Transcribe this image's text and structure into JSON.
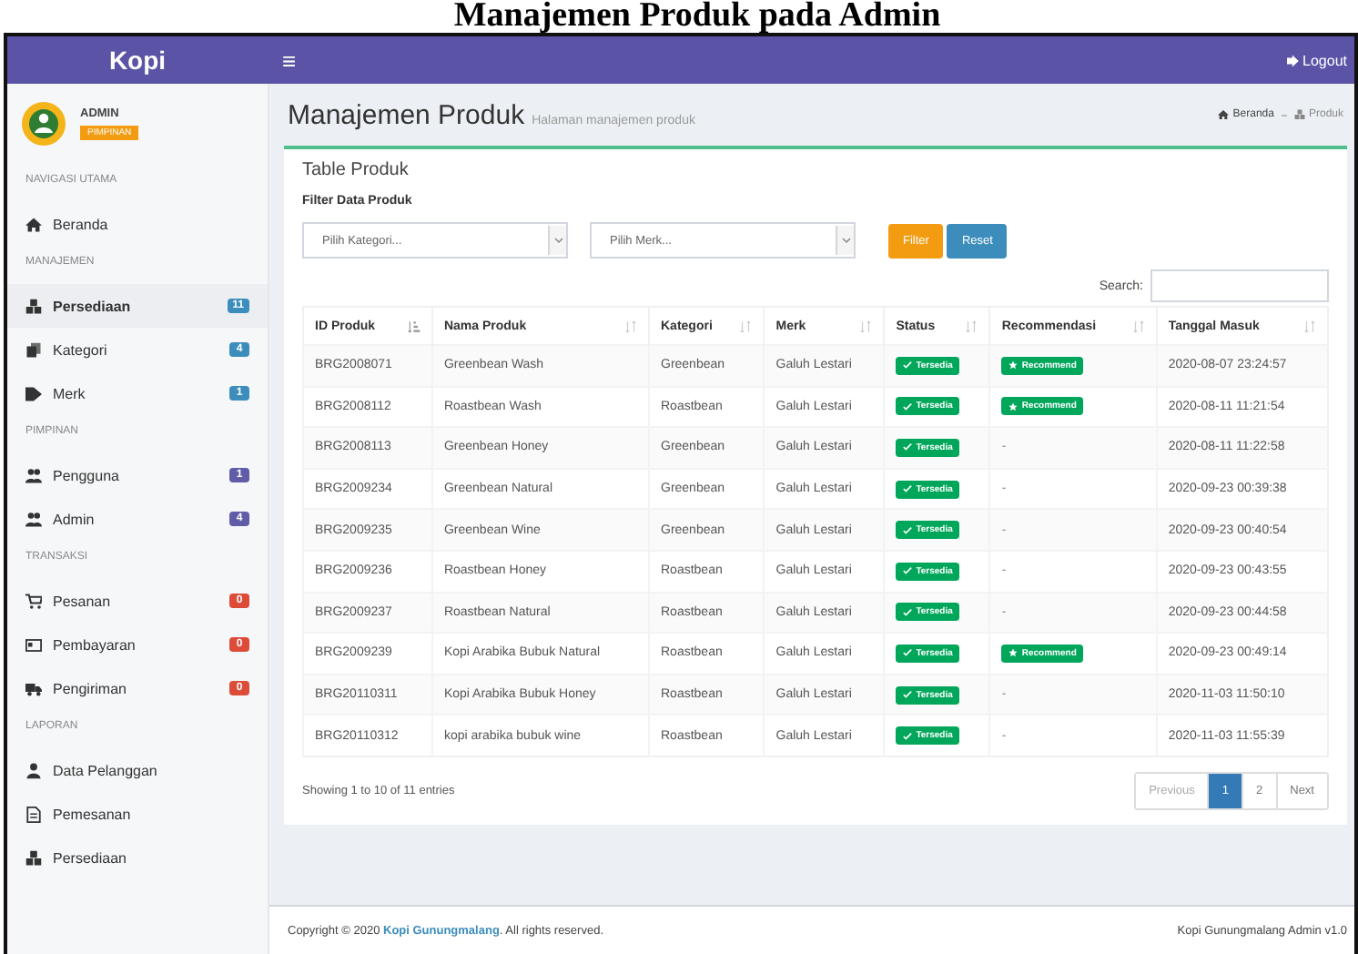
{
  "caption": "Manajemen Produk pada Admin",
  "topbar": {
    "brand": "Kopi",
    "menu_glyph": "≡",
    "logout": "Logout"
  },
  "user": {
    "name": "ADMIN",
    "role": "PIMPINAN"
  },
  "sidebar": [
    {
      "kind": "header",
      "label": "NAVIGASI UTAMA"
    },
    {
      "kind": "link",
      "label": "Beranda",
      "selected": false
    },
    {
      "kind": "header",
      "label": "MANAJEMEN"
    },
    {
      "kind": "link",
      "label": "Persediaan",
      "selected": true,
      "badge": "11",
      "color": "#3c8dbc"
    },
    {
      "kind": "link",
      "label": "Kategori",
      "selected": false,
      "badge": "4",
      "color": "#3c8dbc"
    },
    {
      "kind": "link",
      "label": "Merk",
      "selected": false,
      "badge": "1",
      "color": "#3c8dbc"
    },
    {
      "kind": "header",
      "label": "PIMPINAN"
    },
    {
      "kind": "link",
      "label": "Pengguna",
      "selected": false,
      "badge": "1",
      "color": "#605ca8"
    },
    {
      "kind": "link",
      "label": "Admin",
      "selected": false,
      "badge": "4",
      "color": "#605ca8"
    },
    {
      "kind": "header",
      "label": "TRANSAKSI"
    },
    {
      "kind": "link",
      "label": "Pesanan",
      "selected": false,
      "badge": "0",
      "color": "#dd4b39"
    },
    {
      "kind": "link",
      "label": "Pembayaran",
      "selected": false,
      "badge": "0",
      "color": "#dd4b39"
    },
    {
      "kind": "link",
      "label": "Pengiriman",
      "selected": false,
      "badge": "0",
      "color": "#dd4b39"
    },
    {
      "kind": "header",
      "label": "LAPORAN"
    },
    {
      "kind": "link",
      "label": "Data Pelanggan",
      "selected": false
    },
    {
      "kind": "link",
      "label": "Pemesanan",
      "selected": false
    },
    {
      "kind": "link",
      "label": "Persediaan",
      "selected": false
    }
  ],
  "page": {
    "title": "Manajemen Produk",
    "subtitle": "Halaman manajemen produk",
    "breadcrumb": [
      "Beranda",
      "Produk"
    ]
  },
  "card": {
    "title": "Table Produk",
    "filter_title": "Filter Data Produk",
    "category_placeholder": "Pilih Kategori...",
    "brand_placeholder": "Pilih Merk...",
    "filter_button": "Filter",
    "reset_button": "Reset",
    "search_label": "Search:"
  },
  "table": {
    "columns": [
      {
        "label": "ID Produk",
        "sorted": true
      },
      {
        "label": "Nama Produk",
        "sorted": false
      },
      {
        "label": "Kategori",
        "sorted": false
      },
      {
        "label": "Merk",
        "sorted": false
      },
      {
        "label": "Status",
        "sorted": false
      },
      {
        "label": "Recommendasi",
        "sorted": false
      },
      {
        "label": "Tanggal Masuk",
        "sorted": false
      }
    ],
    "rows": [
      {
        "id": "BRG2008071",
        "name": "Greenbean Wash",
        "kategori": "Greenbean",
        "merk": "Galuh Lestari",
        "status": "Tersedia",
        "recommended": true,
        "recommendasi": "Recommend",
        "tanggal": "2020-08-07 23:24:57"
      },
      {
        "id": "BRG2008112",
        "name": "Roastbean Wash",
        "kategori": "Roastbean",
        "merk": "Galuh Lestari",
        "status": "Tersedia",
        "recommended": true,
        "recommendasi": "Recommend",
        "tanggal": "2020-08-11 11:21:54"
      },
      {
        "id": "BRG2008113",
        "name": "Greenbean Honey",
        "kategori": "Greenbean",
        "merk": "Galuh Lestari",
        "status": "Tersedia",
        "recommended": false,
        "recommendasi": "-",
        "tanggal": "2020-08-11 11:22:58"
      },
      {
        "id": "BRG2009234",
        "name": "Greenbean Natural",
        "kategori": "Greenbean",
        "merk": "Galuh Lestari",
        "status": "Tersedia",
        "recommended": false,
        "recommendasi": "-",
        "tanggal": "2020-09-23 00:39:38"
      },
      {
        "id": "BRG2009235",
        "name": "Greenbean Wine",
        "kategori": "Greenbean",
        "merk": "Galuh Lestari",
        "status": "Tersedia",
        "recommended": false,
        "recommendasi": "-",
        "tanggal": "2020-09-23 00:40:54"
      },
      {
        "id": "BRG2009236",
        "name": "Roastbean Honey",
        "kategori": "Roastbean",
        "merk": "Galuh Lestari",
        "status": "Tersedia",
        "recommended": false,
        "recommendasi": "-",
        "tanggal": "2020-09-23 00:43:55"
      },
      {
        "id": "BRG2009237",
        "name": "Roastbean Natural",
        "kategori": "Roastbean",
        "merk": "Galuh Lestari",
        "status": "Tersedia",
        "recommended": false,
        "recommendasi": "-",
        "tanggal": "2020-09-23 00:44:58"
      },
      {
        "id": "BRG2009239",
        "name": "Kopi Arabika Bubuk Natural",
        "kategori": "Roastbean",
        "merk": "Galuh Lestari",
        "status": "Tersedia",
        "recommended": true,
        "recommendasi": "Recommend",
        "tanggal": "2020-09-23 00:49:14"
      },
      {
        "id": "BRG20110311",
        "name": "Kopi Arabika Bubuk Honey",
        "kategori": "Roastbean",
        "merk": "Galuh Lestari",
        "status": "Tersedia",
        "recommended": false,
        "recommendasi": "-",
        "tanggal": "2020-11-03 11:50:10"
      },
      {
        "id": "BRG20110312",
        "name": "kopi arabika bubuk wine",
        "kategori": "Roastbean",
        "merk": "Galuh Lestari",
        "status": "Tersedia",
        "recommended": false,
        "recommendasi": "-",
        "tanggal": "2020-11-03 11:55:39"
      }
    ]
  },
  "info": "Showing 1 to 10 of 11 entries",
  "pagination": [
    {
      "label": "Previous",
      "selected": false,
      "disabled": true
    },
    {
      "label": "1",
      "selected": true,
      "disabled": false
    },
    {
      "label": "2",
      "selected": false,
      "disabled": false
    },
    {
      "label": "Next",
      "selected": false,
      "disabled": false
    }
  ],
  "footer": {
    "copyright": "Copyright © 2020 **Kopi Gunungmalang**. All rights reserved.",
    "version": "Kopi Gunungmalang Admin v1.0"
  }
}
